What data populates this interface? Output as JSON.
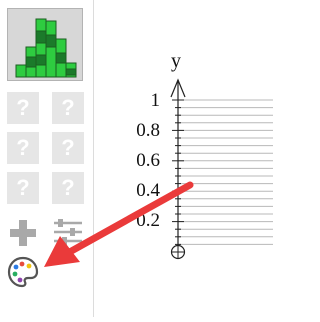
{
  "toolbar": {
    "selected_chart": "histogram-icon",
    "placeholder_glyph": "?",
    "placeholders": [
      "?",
      "?",
      "?",
      "?",
      "?",
      "?"
    ],
    "icons": [
      "plus-icon",
      "sliders-icon",
      "palette-icon"
    ],
    "colors": {
      "tile_bg": "#d7d7d7",
      "placeholder_bg": "#e6e6e6",
      "icon_gray": "#a9a9a9",
      "histogram_green": "#2ecc40",
      "histogram_dark": "#1b7a2a"
    }
  },
  "graph": {
    "axis_label": "y",
    "ticks": [
      "1",
      "0.8",
      "0.6",
      "0.4",
      "0.2"
    ]
  },
  "annotation": {
    "arrow_color": "#ea3a3a",
    "points_to": "palette-icon"
  }
}
